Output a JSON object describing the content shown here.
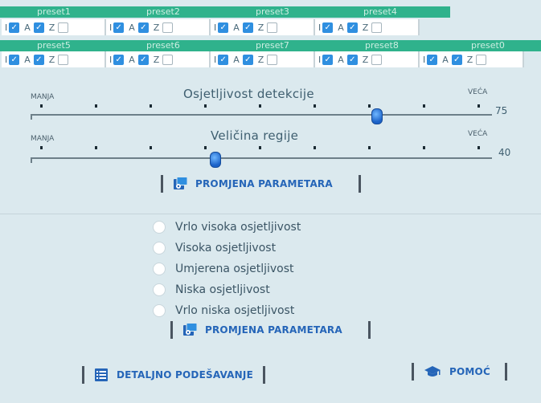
{
  "presets_row1": [
    {
      "name": "preset1",
      "i": true,
      "a": true,
      "z": false
    },
    {
      "name": "preset2",
      "i": true,
      "a": true,
      "z": false
    },
    {
      "name": "preset3",
      "i": true,
      "a": true,
      "z": false
    },
    {
      "name": "preset4",
      "i": true,
      "a": true,
      "z": false
    }
  ],
  "presets_row2": [
    {
      "name": "preset5",
      "i": true,
      "a": true,
      "z": false
    },
    {
      "name": "preset6",
      "i": true,
      "a": true,
      "z": false
    },
    {
      "name": "preset7",
      "i": true,
      "a": true,
      "z": false
    },
    {
      "name": "preset8",
      "i": true,
      "a": true,
      "z": false
    },
    {
      "name": "preset0",
      "i": true,
      "a": true,
      "z": false
    }
  ],
  "checkbox_labels": {
    "i": "I",
    "a": "A",
    "z": "Z"
  },
  "slider1": {
    "title": "Osjetljivost detekcije",
    "min_label": "MANJA",
    "max_label": "VEĆA",
    "value": 75,
    "value_text": "75"
  },
  "slider2": {
    "title": "Veličina regije",
    "min_label": "MANJA",
    "max_label": "VEĆA",
    "value": 40,
    "value_text": "40"
  },
  "apply_button_1": "PROMJENA PARAMETARA",
  "sensitivity_options": [
    "Vrlo visoka osjetljivost",
    "Visoka osjetljivost",
    "Umjerena osjetljivost",
    "Niska osjetljivost",
    "Vrlo niska osjetljivost"
  ],
  "apply_button_2": "PROMJENA PARAMETARA",
  "detail_button": "DETALJNO PODEŠAVANJE",
  "help_button": "POMOĆ",
  "colors": {
    "tab_green": "#2fb28c",
    "accent_blue": "#2565b8",
    "background": "#dbe9ee"
  }
}
